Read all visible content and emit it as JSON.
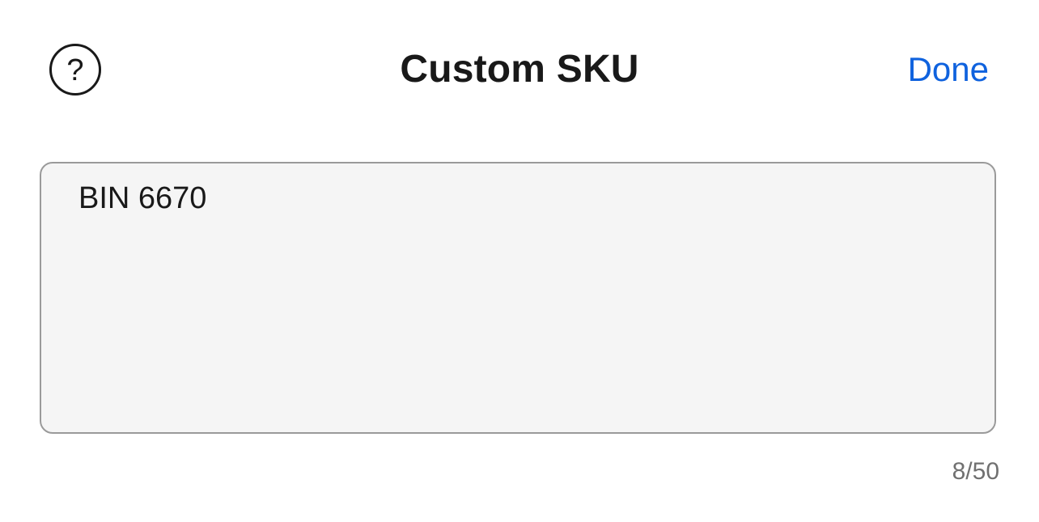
{
  "header": {
    "help_icon": "question-circle-icon",
    "title": "Custom SKU",
    "done_label": "Done"
  },
  "sku_field": {
    "value": "BIN 6670"
  },
  "counter": {
    "text": "8/50",
    "current": 8,
    "max": 50
  },
  "colors": {
    "accent": "#0f62de",
    "text_primary": "#191919",
    "field_background": "#f5f5f5",
    "field_border": "#9a9a9a",
    "counter_text": "#707070"
  }
}
